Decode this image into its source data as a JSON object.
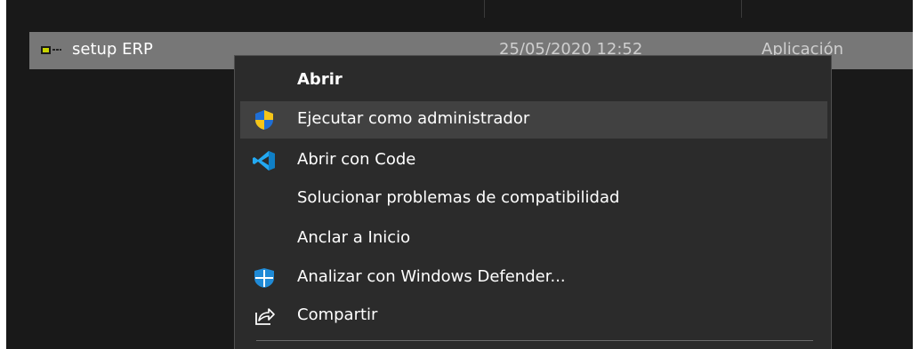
{
  "file_list": {
    "row": {
      "name": "setup ERP",
      "modified": "25/05/2020 12:52",
      "type": "Aplicación",
      "icon": "application-icon"
    }
  },
  "context_menu": {
    "items": [
      {
        "label": "Abrir",
        "icon": "",
        "bold": true
      },
      {
        "label": "Ejecutar como administrador",
        "icon": "uac-shield-icon",
        "highlighted": true
      },
      {
        "label": "Abrir con Code",
        "icon": "vscode-icon"
      },
      {
        "label": "Solucionar problemas de compatibilidad",
        "icon": ""
      },
      {
        "label": "Anclar a Inicio",
        "icon": ""
      },
      {
        "label": "Analizar con Windows Defender...",
        "icon": "windows-defender-icon"
      },
      {
        "label": "Compartir",
        "icon": "share-icon"
      }
    ]
  },
  "colors": {
    "background": "#191919",
    "selected_row": "#777777",
    "menu_background": "#2b2b2b",
    "menu_highlight": "#414141",
    "vscode_blue": "#23a9f2",
    "defender_blue": "#1f8ad6",
    "uac_yellow": "#f5c518"
  }
}
